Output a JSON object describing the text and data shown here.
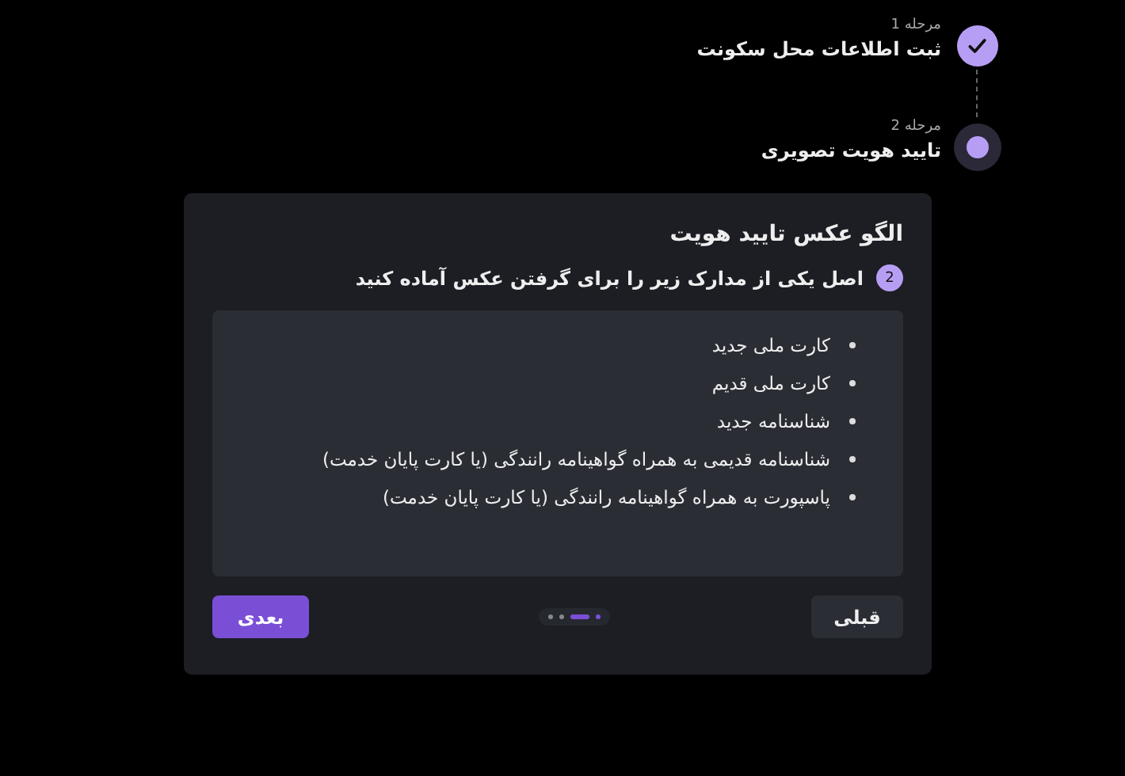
{
  "steps": [
    {
      "label": "مرحله 1",
      "title": "ثبت اطلاعات محل سکونت",
      "kind": "done"
    },
    {
      "label": "مرحله 2",
      "title": "تایید هویت تصویری",
      "kind": "current"
    }
  ],
  "card": {
    "title": "الگو عکس تایید هویت",
    "badge": "2",
    "instruction": "اصل یکی از مدارک زیر را برای گرفتن عکس آماده کنید",
    "documents": [
      "کارت ملی جدید",
      "کارت ملی قدیم",
      "شناسنامه جدید",
      "شناسنامه قدیمی به همراه گواهینامه رانندگی (یا کارت پایان خدمت)",
      "پاسپورت به همراه گواهینامه رانندگی (یا کارت پایان خدمت)"
    ],
    "pager": [
      {
        "selected": false,
        "done": true
      },
      {
        "selected": true,
        "done": false
      },
      {
        "selected": false,
        "done": false
      },
      {
        "selected": false,
        "done": false
      }
    ],
    "buttons": {
      "previous": "قبلی",
      "next": "بعدی"
    }
  }
}
